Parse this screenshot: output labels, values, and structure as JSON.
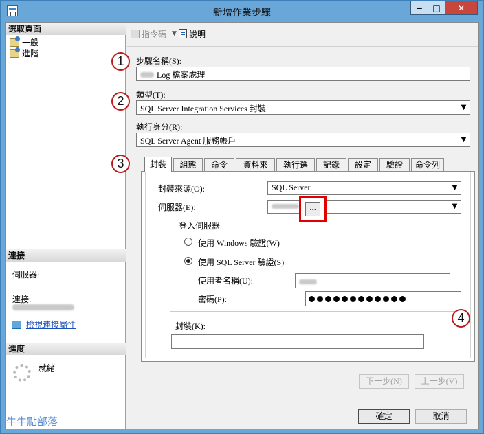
{
  "window": {
    "title": "新增作業步驟"
  },
  "titlebar_buttons": {
    "minimize": "━",
    "maximize": "□",
    "close": "✕"
  },
  "left_pane": {
    "select_page_header": "選取頁面",
    "pages": [
      "一般",
      "進階"
    ],
    "connection_header": "連接",
    "server_label": "伺服器:",
    "server_value": ".",
    "connection_label": "連接:",
    "view_connection_link": "檢視連接屬性",
    "progress_header": "進度",
    "progress_status": "就緒",
    "watermark": "牛牛點部落"
  },
  "toolbar": {
    "script_label": "指令碼",
    "help_label": "說明"
  },
  "form": {
    "step_name_label": "步驟名稱(S):",
    "step_name_value": "Log 檔案處理",
    "type_label": "類型(T):",
    "type_value": "SQL Server Integration Services 封裝",
    "run_as_label": "執行身分(R):",
    "run_as_value": "SQL Server Agent 服務帳戶"
  },
  "tabs": [
    "封裝",
    "組態",
    "命令檔",
    "資料來源",
    "執行選項",
    "記錄",
    "設定值",
    "驗證",
    "命令列"
  ],
  "package_tab": {
    "source_label": "封裝來源(O):",
    "source_value": "SQL Server",
    "server_label": "伺服器(E):",
    "logon_group_title": "登入伺服器",
    "windows_auth_label": "使用 Windows 驗證(W)",
    "sql_auth_label": "使用 SQL Server 驗證(S)",
    "sql_auth_selected": true,
    "username_label": "使用者名稱(U):",
    "password_label": "密碼(P):",
    "password_mask_count": 12,
    "package_label": "封裝(K):",
    "package_value": "",
    "browse_button": "..."
  },
  "callouts": [
    "1",
    "2",
    "3",
    "4"
  ],
  "nav_buttons": {
    "next": "下一步(N)",
    "previous": "上一步(V)"
  },
  "footer_buttons": {
    "ok": "確定",
    "cancel": "取消"
  },
  "colors": {
    "titlebar": "#69a7d9",
    "close_button": "#c9463d",
    "highlight_border": "#e00000",
    "callout_border": "#b81c1c"
  }
}
